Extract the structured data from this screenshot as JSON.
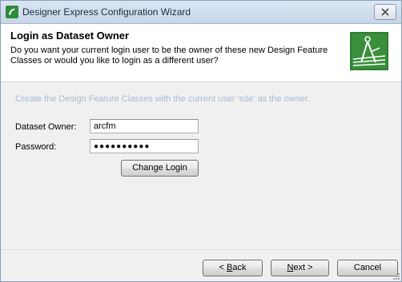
{
  "window": {
    "title": "Designer Express Configuration Wizard"
  },
  "header": {
    "title": "Login as Dataset Owner",
    "description": "Do you want your current login user to be the owner of these new Design Feature Classes or would you like to login as a different user?"
  },
  "body": {
    "hint": "Create the Design Feature Classes with the current user 'sde' as the owner.",
    "dataset_owner_label": "Dataset Owner:",
    "dataset_owner_value": "arcfm",
    "password_label": "Password:",
    "password_value": "●●●●●●●●●●",
    "change_login_label": "Change Login"
  },
  "footer": {
    "back_prefix": "< ",
    "back_mnemonic": "B",
    "back_rest": "ack",
    "next_mnemonic": "N",
    "next_rest": "ext >",
    "cancel_label": "Cancel"
  },
  "icons": {
    "app": "wizard-app-icon",
    "close": "close-icon",
    "logo": "drafting-compass-icon"
  },
  "colors": {
    "hint_text": "#a6bccf",
    "logo_bg": "#2e7d32"
  }
}
